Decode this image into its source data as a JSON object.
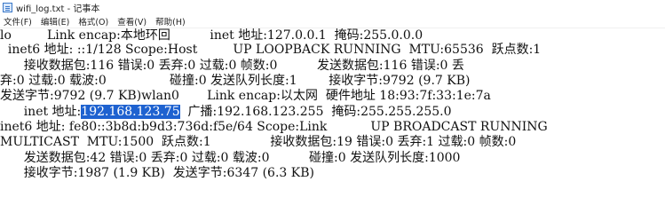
{
  "window": {
    "title": "wifi_log.txt - 记事本"
  },
  "menu": {
    "items": [
      "文件(F)",
      "编辑(E)",
      "格式(O)",
      "查看(V)",
      "帮助(H)"
    ]
  },
  "editor": {
    "lines": [
      "lo         Link encap:本地环回          inet 地址:127.0.0.1  掩码:255.0.0.0",
      "  inet6 地址: ::1/128 Scope:Host         UP LOOPBACK RUNNING  MTU:65536  跃点数:1",
      "      接收数据包:116 错误:0 丢弃:0 过载:0 帧数:0          发送数据包:116 错误:0 丢",
      "弃:0 过载:0 载波:0                碰撞:0 发送队列长度:1        接收字节:9792 (9.7 KB)",
      "发送字节:9792 (9.7 KB)wlan0       Link encap:以太网  硬件地址 18:93:7f:33:1e:7a",
      "      ",
      "inet6 地址: fe80::3b8d:b9d3:736d:f5e/64 Scope:Link           UP BROADCAST RUNNING",
      "MULTICAST  MTU:1500  跃点数:1               接收数据包:19 错误:0 丢弃:1 过载:0 帧数:0",
      "      发送数据包:42 错误:0 丢弃:0 过载:0 载波:0          碰撞:0 发送队列长度:1000",
      "      接收字节:1987 (1.9 KB)  发送字节:6347 (6.3 KB)"
    ],
    "line5": {
      "before": "      inet 地址:",
      "selected": "192.168.123.75",
      "after": "  广播:192.168.123.255  掩码:255.255.255.0"
    }
  }
}
